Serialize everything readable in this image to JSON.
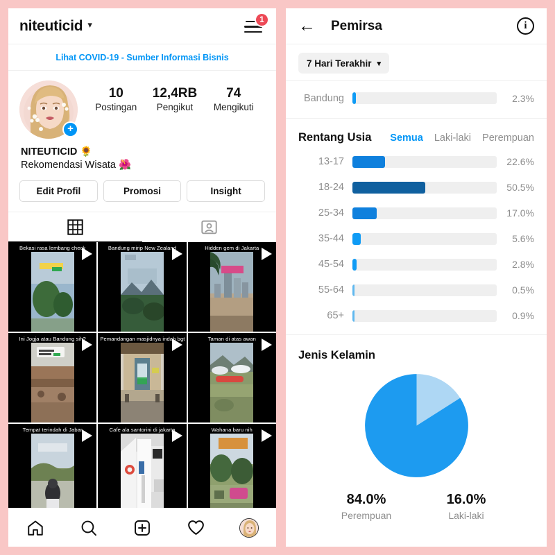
{
  "theme": {
    "page_bg": "#f9c7c6",
    "accent_blue": "#0095f6",
    "bar_blue": "#0f80dd",
    "bar_blue_dark": "#10609f",
    "pie_main": "#1d9bf0",
    "pie_light": "#aed7f4",
    "badge_red": "#ed4956",
    "muted": "#8e8e8e"
  },
  "left": {
    "topbar": {
      "username": "niteuticid",
      "chevron": "chevron-down",
      "menu_badge_count": "1"
    },
    "covid_banner": "Lihat COVID-19 - Sumber Informasi Bisnis",
    "profile": {
      "plus_badge": "+",
      "stats": [
        {
          "value": "10",
          "label": "Postingan"
        },
        {
          "value": "12,4RB",
          "label": "Pengikut"
        },
        {
          "value": "74",
          "label": "Mengikuti"
        }
      ],
      "bio_name": "NITEUTICID 🌻",
      "bio_desc": "Rekomendasi Wisata 🌺"
    },
    "actions": [
      {
        "label": "Edit Profil"
      },
      {
        "label": "Promosi"
      },
      {
        "label": "Insight"
      }
    ],
    "tabs": [
      {
        "icon": "grid-icon",
        "active": true
      },
      {
        "icon": "tagged-person-icon",
        "active": false
      }
    ],
    "grid": [
      {
        "caption": "Bekasi rasa lembang check",
        "type": "reel"
      },
      {
        "caption": "Bandung mirip New Zealand",
        "type": "reel"
      },
      {
        "caption": "Hidden gem di Jakarta",
        "type": "reel"
      },
      {
        "caption": "Ini Jogja atau Bandung sih?",
        "type": "reel"
      },
      {
        "caption": "Pemandangan masjidnya indah bgt",
        "type": "reel"
      },
      {
        "caption": "Taman di atas awan",
        "type": "reel"
      },
      {
        "caption": "Tempat terindah di Jabar",
        "type": "reel"
      },
      {
        "caption": "Cafe ala santorini di jakarta",
        "type": "reel"
      },
      {
        "caption": "Wahana baru nih",
        "type": "reel"
      }
    ],
    "bottom_nav": [
      {
        "icon": "home-icon"
      },
      {
        "icon": "search-icon"
      },
      {
        "icon": "add-post-icon"
      },
      {
        "icon": "heart-icon"
      },
      {
        "icon": "profile-avatar-icon"
      }
    ]
  },
  "right": {
    "topbar": {
      "back_icon": "back-arrow-icon",
      "title": "Pemirsa",
      "info_icon": "info-icon",
      "info_glyph": "i"
    },
    "date_range": {
      "label": "7 Hari Terakhir",
      "chevron": "⌄"
    },
    "location_row": {
      "label": "Bandung",
      "value": "2.3%",
      "pct": 2.3
    },
    "age": {
      "title": "Rentang Usia",
      "tabs": [
        {
          "label": "Semua",
          "active": true
        },
        {
          "label": "Laki-laki",
          "active": false
        },
        {
          "label": "Perempuan",
          "active": false
        }
      ]
    },
    "gender": {
      "title": "Jenis Kelamin",
      "legend": [
        {
          "value": "84.0%",
          "label": "Perempuan"
        },
        {
          "value": "16.0%",
          "label": "Laki-laki"
        }
      ]
    }
  },
  "chart_data": [
    {
      "type": "bar",
      "title": "Rentang Usia",
      "orientation": "horizontal",
      "categories": [
        "13-17",
        "18-24",
        "25-34",
        "35-44",
        "45-54",
        "55-64",
        "65+"
      ],
      "values": [
        22.6,
        50.5,
        17.0,
        5.6,
        2.8,
        0.5,
        0.9
      ],
      "labels": [
        "22.6%",
        "50.5%",
        "17.0%",
        "5.6%",
        "2.8%",
        "0.5%",
        "0.9%"
      ],
      "colors": [
        "#0f80dd",
        "#10609f",
        "#0f80dd",
        "#0f9bf5",
        "#0f9bf5",
        "#5fb8ef",
        "#5fb8ef"
      ],
      "xlabel": "",
      "ylabel": "",
      "xlim": [
        0,
        100
      ],
      "grid": false,
      "legend": null,
      "track_scale_max": 100
    },
    {
      "type": "bar",
      "title": "Bandung",
      "orientation": "horizontal",
      "categories": [
        "Bandung"
      ],
      "values": [
        2.3
      ],
      "labels": [
        "2.3%"
      ],
      "colors": [
        "#0f9bf5"
      ],
      "xlim": [
        0,
        100
      ],
      "grid": false,
      "legend": null
    },
    {
      "type": "pie",
      "title": "Jenis Kelamin",
      "categories": [
        "Laki-laki",
        "Perempuan"
      ],
      "values": [
        16.0,
        84.0
      ],
      "labels": [
        "16.0%",
        "84.0%"
      ],
      "colors": [
        "#aed7f4",
        "#1d9bf0"
      ],
      "start_angle_deg": 0,
      "direction": "clockwise",
      "legend": "bottom"
    }
  ]
}
